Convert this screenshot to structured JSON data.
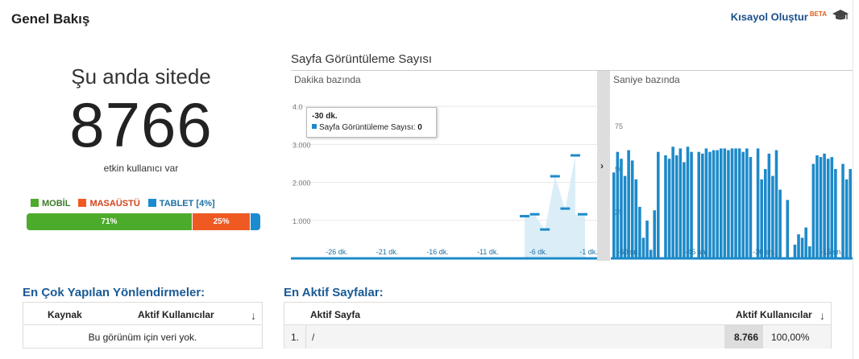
{
  "header": {
    "title": "Genel Bakış",
    "shortcut_label": "Kısayol Oluştur",
    "beta_label": "BETA"
  },
  "now": {
    "label": "Şu anda sitede",
    "count": "8766",
    "sub": "etkin kullanıcı var"
  },
  "devices": {
    "legend": [
      {
        "label": "MOBİL",
        "color": "#4dab2b"
      },
      {
        "label": "MASAÜSTÜ",
        "color": "#ef5a23"
      },
      {
        "label": "TABLET [4%]",
        "color": "#1b8ccf"
      }
    ],
    "mobile_pct": "71%",
    "desktop_pct": "25%",
    "tablet_pct": 4
  },
  "chart_title": "Sayfa Görüntüleme Sayısı",
  "chart_data": [
    {
      "type": "area",
      "title": "Dakika bazında",
      "yticks": [
        "4.0",
        "3.000",
        "2.000",
        "1.000"
      ],
      "ytick_values": [
        4000,
        3000,
        2000,
        1000
      ],
      "xticks": [
        "-26 dk.",
        "-21 dk.",
        "-16 dk.",
        "-11 dk.",
        "-6 dk.",
        "-1 dk."
      ],
      "xtick_values": [
        -26,
        -21,
        -16,
        -11,
        -6,
        -1
      ],
      "x": [
        -30,
        -29,
        -28,
        -27,
        -26,
        -25,
        -24,
        -23,
        -22,
        -21,
        -20,
        -19,
        -18,
        -17,
        -16,
        -15,
        -14,
        -13,
        -12,
        -11,
        -10,
        -9,
        -8,
        -7,
        -6,
        -5,
        -4,
        -3,
        -2,
        -1
      ],
      "values": [
        0,
        0,
        0,
        0,
        0,
        0,
        0,
        0,
        0,
        0,
        0,
        0,
        0,
        0,
        0,
        0,
        0,
        0,
        0,
        0,
        0,
        0,
        0,
        0,
        1100,
        1150,
        750,
        2150,
        1300,
        2700
      ],
      "last_value": 1150,
      "ylim": [
        0,
        4300
      ]
    },
    {
      "type": "bar",
      "title": "Saniye bazında",
      "yticks": [
        "75",
        "50",
        "25"
      ],
      "ytick_values": [
        75,
        50,
        25
      ],
      "xticks": [
        "-60 sn.",
        "-45 sn.",
        "-30 sn.",
        "-15 sn."
      ],
      "xtick_values": [
        -60,
        -45,
        -30,
        -15
      ],
      "values": [
        50,
        62,
        58,
        48,
        63,
        57,
        46,
        30,
        12,
        22,
        5,
        28,
        62,
        0,
        60,
        58,
        65,
        60,
        64,
        56,
        65,
        62,
        0,
        62,
        61,
        64,
        62,
        63,
        63,
        64,
        64,
        63,
        64,
        64,
        64,
        62,
        64,
        59,
        0,
        64,
        46,
        52,
        61,
        48,
        63,
        40,
        0,
        34,
        0,
        8,
        14,
        12,
        18,
        7,
        55,
        60,
        59,
        61,
        58,
        59,
        52,
        0,
        55,
        46,
        52
      ],
      "ylim": [
        0,
        82
      ]
    }
  ],
  "tooltip": {
    "title": "-30 dk.",
    "series": "Sayfa Görüntüleme Sayısı",
    "value": "0"
  },
  "referrals": {
    "title": "En Çok Yapılan Yönlendirmeler:",
    "col_source": "Kaynak",
    "col_users": "Aktif Kullanıcılar",
    "empty": "Bu görünüm için veri yok."
  },
  "pages": {
    "title": "En Aktif Sayfalar:",
    "col_page": "Aktif Sayfa",
    "col_users": "Aktif Kullanıcılar",
    "rows": [
      {
        "num": "1.",
        "page": "/",
        "users": "8.766",
        "pct": "100,00%"
      }
    ]
  }
}
